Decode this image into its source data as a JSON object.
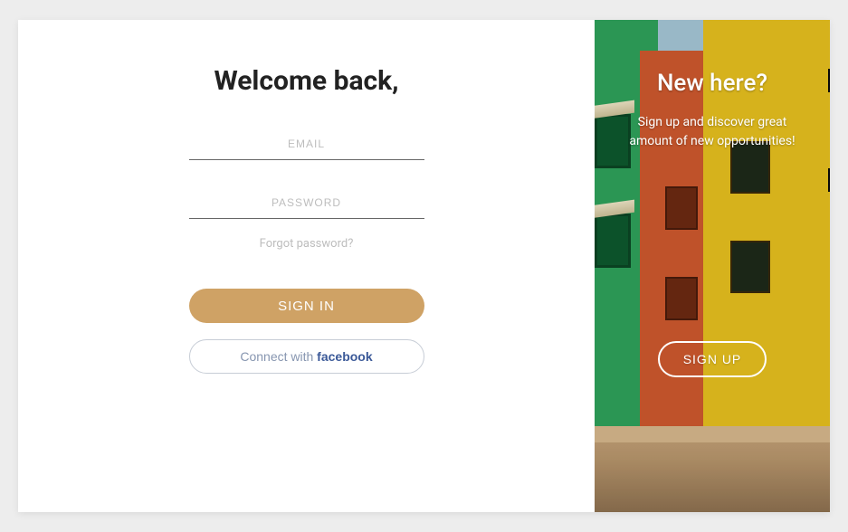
{
  "login": {
    "title": "Welcome back,",
    "email_placeholder": "EMAIL",
    "password_placeholder": "PASSWORD",
    "forgot_label": "Forgot password?",
    "signin_label": "SIGN IN",
    "facebook_prefix": "Connect with ",
    "facebook_brand": "facebook"
  },
  "signup": {
    "title": "New here?",
    "subtitle": "Sign up and discover great amount of new opportunities!",
    "button_label": "SIGN UP"
  }
}
